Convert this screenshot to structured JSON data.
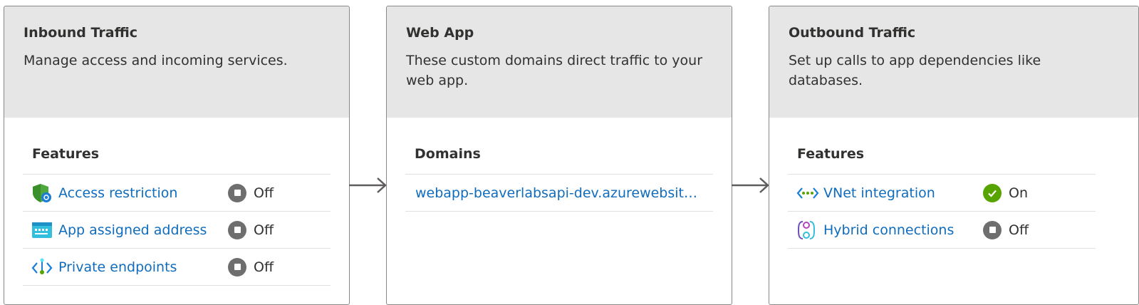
{
  "inbound": {
    "title": "Inbound Traffic",
    "description": "Manage access and incoming services.",
    "section_title": "Features",
    "items": [
      {
        "label": "Access restriction",
        "status": "Off",
        "icon": "shield-icon"
      },
      {
        "label": "App assigned address",
        "status": "Off",
        "icon": "address-icon"
      },
      {
        "label": "Private endpoints",
        "status": "Off",
        "icon": "endpoint-icon"
      }
    ]
  },
  "webapp": {
    "title": "Web App",
    "description": "These custom domains direct traffic to your web app.",
    "section_title": "Domains",
    "domains": [
      "webapp-beaverlabsapi-dev.azurewebsites.net"
    ]
  },
  "outbound": {
    "title": "Outbound Traffic",
    "description": "Set up calls to app dependencies like databases.",
    "section_title": "Features",
    "items": [
      {
        "label": "VNet integration",
        "status": "On",
        "icon": "vnet-icon"
      },
      {
        "label": "Hybrid connections",
        "status": "Off",
        "icon": "hybrid-connection-icon"
      }
    ]
  },
  "colors": {
    "link": "#0f6cbd",
    "header_bg": "#e6e6e6",
    "status_on": "#57a300",
    "status_off": "#6e6e6e"
  }
}
